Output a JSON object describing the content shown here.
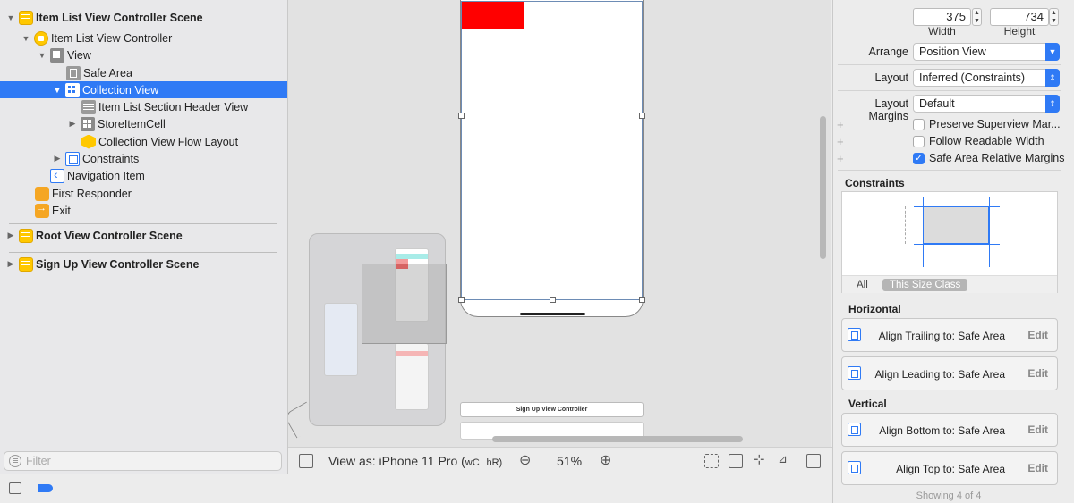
{
  "outline": {
    "rows": [
      {
        "label": "Item List View Controller Scene"
      },
      {
        "label": "Item List View Controller"
      },
      {
        "label": "View"
      },
      {
        "label": "Safe Area"
      },
      {
        "label": "Collection View"
      },
      {
        "label": "Item List Section Header View"
      },
      {
        "label": "StoreItemCell"
      },
      {
        "label": "Collection View Flow Layout"
      },
      {
        "label": "Constraints"
      },
      {
        "label": "Navigation Item"
      },
      {
        "label": "First Responder"
      },
      {
        "label": "Exit"
      }
    ],
    "scenes": [
      {
        "label": "Root View Controller Scene"
      },
      {
        "label": "Sign Up View Controller Scene"
      }
    ],
    "filter_placeholder": "Filter"
  },
  "canvas": {
    "bottom_scene_label": "Sign Up View Controller",
    "view_as": "View as: iPhone 11 Pro (",
    "size_class_w": "wC",
    "size_class_h": "hR)",
    "zoom": "51%"
  },
  "inspector": {
    "width_value": "375",
    "height_value": "734",
    "width_label": "Width",
    "height_label": "Height",
    "arrange_label": "Arrange",
    "arrange_value": "Position View",
    "layout_label": "Layout",
    "layout_value": "Inferred (Constraints)",
    "margins_label": "Layout Margins",
    "margins_value": "Default",
    "checkboxes": [
      {
        "label": "Preserve Superview Mar...",
        "checked": false
      },
      {
        "label": "Follow Readable Width",
        "checked": false
      },
      {
        "label": "Safe Area Relative Margins",
        "checked": true
      }
    ],
    "constraints_title": "Constraints",
    "tab_all": "All",
    "tab_size_class": "This Size Class",
    "horizontal_title": "Horizontal",
    "vertical_title": "Vertical",
    "constraints": [
      {
        "text": "Align Trailing to:  Safe Area",
        "edit": "Edit"
      },
      {
        "text": "Align Leading to:  Safe Area",
        "edit": "Edit"
      },
      {
        "text": "Align Bottom to:  Safe Area",
        "edit": "Edit"
      },
      {
        "text": "Align Top to:  Safe Area",
        "edit": "Edit"
      }
    ],
    "showing": "Showing 4 of 4"
  },
  "colors": {
    "selection": "#2f7af5",
    "scene_icon": "#ffc800",
    "red_block": "#ff0000"
  }
}
